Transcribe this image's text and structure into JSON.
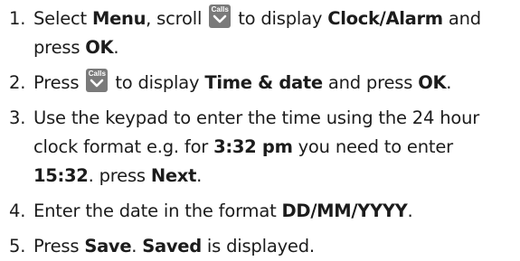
{
  "key_icon": {
    "label": "Calls",
    "glyph": "chevron-down"
  },
  "steps": [
    {
      "number": "1.",
      "t1": "Select ",
      "b1": "Menu",
      "t2": ", scroll ",
      "t3": " to display ",
      "b2": "Clock/Alarm",
      "t4": " and press ",
      "b3": "OK",
      "t5": "."
    },
    {
      "number": "2.",
      "t1": "Press ",
      "t2": " to display ",
      "b1": "Time & date",
      "t3": " and press ",
      "b2": "OK",
      "t4": "."
    },
    {
      "number": "3.",
      "t1": "Use the keypad to enter the time using the 24 hour clock format e.g. for ",
      "b1": "3:32 pm",
      "t2": " you need to enter ",
      "b2": "15:32",
      "t3": ". press ",
      "b3": "Next",
      "t4": "."
    },
    {
      "number": "4.",
      "t1": "Enter the date in the format ",
      "b1": "DD/MM/YYYY",
      "t2": "."
    },
    {
      "number": "5.",
      "t1": "Press ",
      "b1": "Save",
      "t2": ". ",
      "b2": "Saved",
      "t3": " is displayed."
    }
  ]
}
